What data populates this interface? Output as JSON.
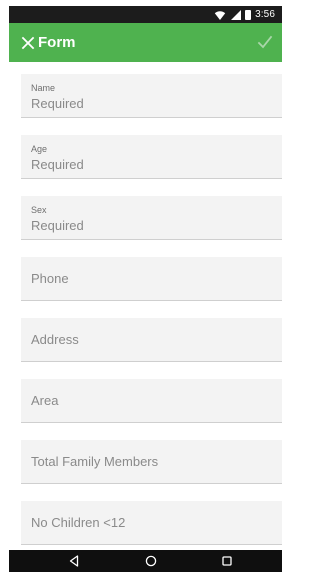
{
  "status_bar": {
    "time": "3:56"
  },
  "app_bar": {
    "title": "Form"
  },
  "fields": [
    {
      "label": "Name",
      "value": "Required"
    },
    {
      "label": "Age",
      "value": "Required"
    },
    {
      "label": "Sex",
      "value": "Required"
    },
    {
      "placeholder": "Phone"
    },
    {
      "placeholder": "Address"
    },
    {
      "placeholder": "Area"
    },
    {
      "placeholder": "Total Family Members"
    },
    {
      "placeholder": "No Children <12"
    }
  ],
  "colors": {
    "app_bar": "#4fb24f",
    "status_bar": "#1c1c1c",
    "nav_bar": "#0f0f0f",
    "field_background": "#f3f3f3"
  },
  "icons": {
    "close": "close-icon",
    "confirm": "check-icon",
    "wifi": "wifi-icon",
    "signal": "signal-icon",
    "battery": "battery-icon",
    "back": "back-icon",
    "home": "home-icon",
    "recents": "recents-icon"
  }
}
